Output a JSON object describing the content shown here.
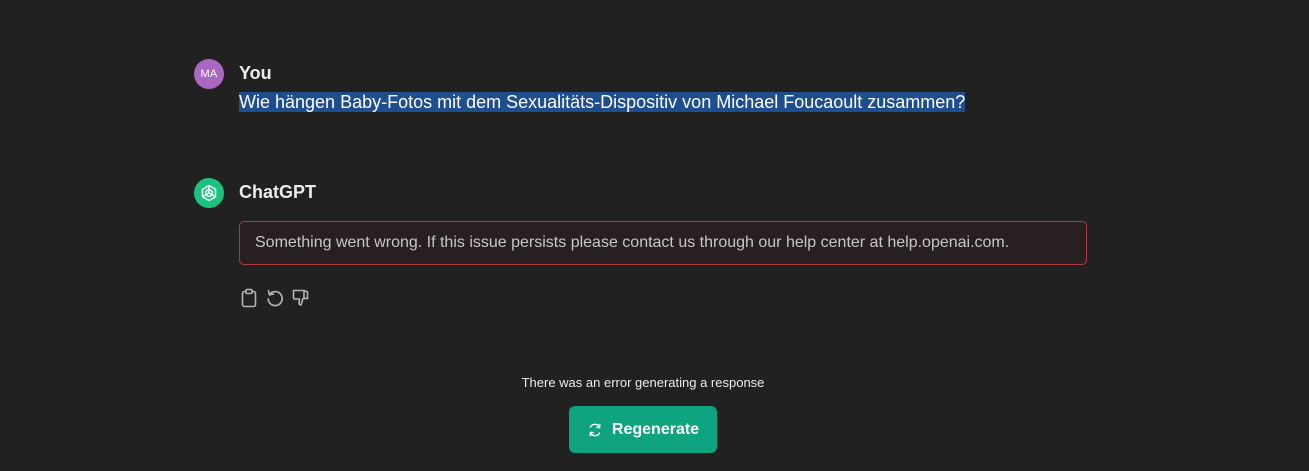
{
  "conversation": {
    "user": {
      "avatar_initials": "MA",
      "name": "You",
      "message": "Wie hängen Baby-Fotos mit dem Sexualitäts-Dispositiv von Michael Foucaoult zusammen?"
    },
    "assistant": {
      "name": "ChatGPT",
      "error_message": "Something went wrong. If this issue persists please contact us through our help center at help.openai.com.",
      "actions": [
        "clipboard-icon",
        "regenerate-icon",
        "thumbs-down-icon"
      ]
    }
  },
  "footer": {
    "error_text": "There was an error generating a response",
    "regenerate_label": "Regenerate"
  },
  "colors": {
    "background": "#212121",
    "user_avatar": "#ab68c2",
    "assistant_avatar": "#19c37d",
    "error_border": "#b33a3a",
    "selection_highlight": "#1f4e8f",
    "regenerate_button": "#10a37f"
  }
}
